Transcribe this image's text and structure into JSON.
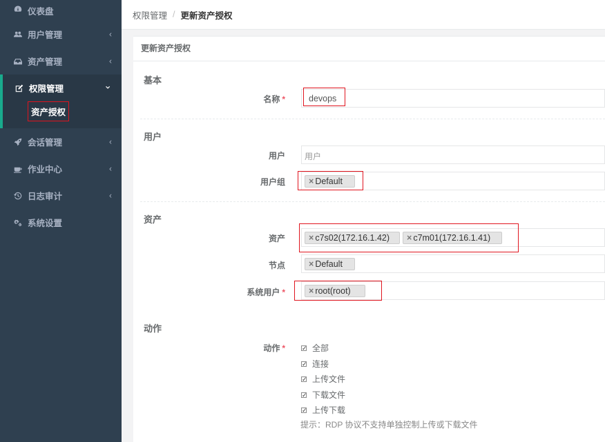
{
  "sidebar": {
    "items": [
      {
        "label": "仪表盘",
        "icon": "dashboard-icon"
      },
      {
        "label": "用户管理",
        "icon": "users-icon"
      },
      {
        "label": "资产管理",
        "icon": "inbox-icon"
      },
      {
        "label": "权限管理",
        "icon": "edit-icon"
      },
      {
        "label": "会话管理",
        "icon": "rocket-icon"
      },
      {
        "label": "作业中心",
        "icon": "coffee-icon"
      },
      {
        "label": "日志审计",
        "icon": "history-icon"
      },
      {
        "label": "系统设置",
        "icon": "cogs-icon"
      }
    ],
    "active_sub": "资产授权",
    "chevron_left": "‹",
    "chevron_down": "⌄"
  },
  "breadcrumb": {
    "parent": "权限管理",
    "separator": "/",
    "current": "更新资产授权"
  },
  "panel": {
    "title": "更新资产授权"
  },
  "form": {
    "basic": {
      "section": "基本",
      "name_label": "名称",
      "name_value": "devops",
      "required_mark": "*"
    },
    "users": {
      "section": "用户",
      "user_label": "用户",
      "user_placeholder": "用户",
      "group_label": "用户组",
      "group_tags": [
        "Default"
      ]
    },
    "assets": {
      "section": "资产",
      "asset_label": "资产",
      "asset_tags": [
        "c7s02(172.16.1.42)",
        "c7m01(172.16.1.41)"
      ],
      "node_label": "节点",
      "node_tags": [
        "Default"
      ],
      "sysuser_label": "系统用户",
      "sysuser_tags": [
        "root(root)"
      ]
    },
    "actions": {
      "section": "动作",
      "label": "动作",
      "options": [
        "全部",
        "连接",
        "上传文件",
        "下载文件",
        "上传下载"
      ],
      "hint": "提示：RDP 协议不支持单独控制上传或下载文件",
      "tag_remove": "×"
    }
  },
  "colors": {
    "sidebar_bg": "#2f4050",
    "active_border": "#19aa8d",
    "highlight": "#e0141e",
    "required": "#ed5565"
  }
}
